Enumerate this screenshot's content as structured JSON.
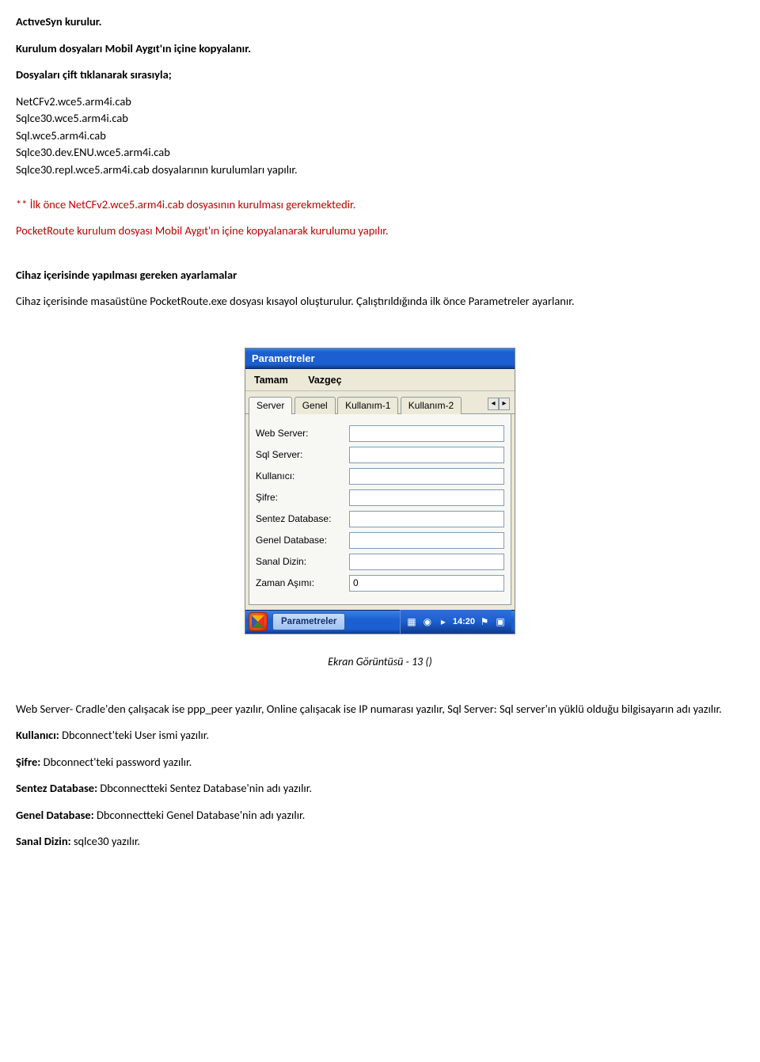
{
  "doc": {
    "p1": "ActıveSyn kurulur.",
    "p2": "Kurulum dosyaları Mobil Aygıt'ın içine kopyalanır.",
    "p3": "Dosyaları çift tıklanarak sırasıyla;",
    "files": {
      "f1": "NetCFv2.wce5.arm4i.cab",
      "f2": "Sqlce30.wce5.arm4i.cab",
      "f3": "Sql.wce5.arm4i.cab",
      "f4": "Sqlce30.dev.ENU.wce5.arm4i.cab",
      "f5": "Sqlce30.repl.wce5.arm4i.cab dosyalarının kurulumları yapılır."
    },
    "p4": "** İlk önce NetCFv2.wce5.arm4i.cab dosyasının kurulması gerekmektedir.",
    "p5": "PocketRoute kurulum dosyası Mobil Aygıt'ın içine kopyalanarak kurulumu yapılır.",
    "p6": "Cihaz içerisinde yapılması gereken ayarlamalar",
    "p7": "Cihaz içerisinde masaüstüne PocketRoute.exe dosyası kısayol oluşturulur. Çalıştırıldığında ilk önce Parametreler ayarlanır.",
    "caption": "Ekran Görüntüsü - 13 ()",
    "p8": "Web Server- Cradle'den çalışacak ise ppp_peer yazılır, Online çalışacak ise IP numarası yazılır, Sql Server: Sql server'ın yüklü olduğu bilgisayarın adı yazılır.",
    "p9_label": "Kullanıcı:",
    "p9_text": " Dbconnect'teki User ismi yazılır.",
    "p10_label": "Şifre:",
    "p10_text": " Dbconnect'teki password yazılır.",
    "p11_label": "Sentez Database:",
    "p11_text": " Dbconnectteki Sentez Database'nin adı yazılır.",
    "p12_label": "Genel Database:",
    "p12_text": " Dbconnectteki Genel Database'nin adı yazılır.",
    "p13_label": "Sanal Dizin:",
    "p13_text": " sqlce30 yazılır."
  },
  "shot": {
    "title": "Parametreler",
    "menu": {
      "tamam": "Tamam",
      "vazgec": "Vazgeç"
    },
    "tabs": {
      "t1": "Server",
      "t2": "Genel",
      "t3": "Kullanım-1",
      "t4": "Kullanım-2"
    },
    "spin": {
      "left": "◂",
      "right": "▸"
    },
    "labels": {
      "web": "Web Server:",
      "sql": "Sql Server:",
      "user": "Kullanıcı:",
      "pass": "Şifre:",
      "sentez": "Sentez Database:",
      "genel": "Genel Database:",
      "sanal": "Sanal Dizin:",
      "zaman": "Zaman Aşımı:"
    },
    "values": {
      "web": "",
      "sql": "",
      "user": "",
      "pass": "",
      "sentez": "",
      "genel": "",
      "sanal": "",
      "zaman": "0"
    },
    "taskbar": {
      "task_label": "Parametreler",
      "tray_sep": "▸",
      "clock": "14:20"
    }
  }
}
